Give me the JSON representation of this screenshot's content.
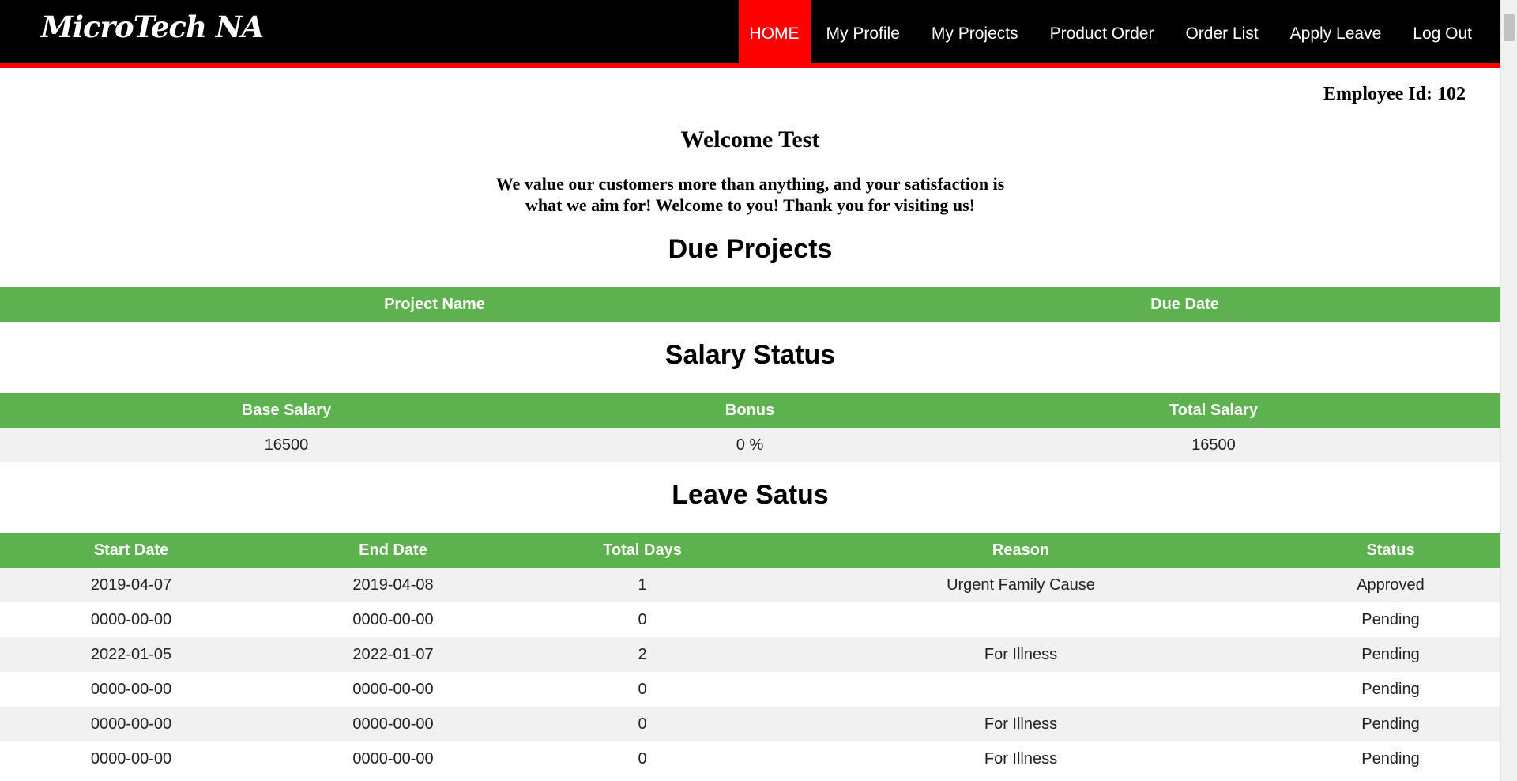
{
  "header": {
    "logo": "MicroTech NA",
    "nav": [
      {
        "label": "HOME",
        "active": true
      },
      {
        "label": "My Profile"
      },
      {
        "label": "My Projects"
      },
      {
        "label": "Product Order"
      },
      {
        "label": "Order List"
      },
      {
        "label": "Apply Leave"
      },
      {
        "label": "Log Out"
      }
    ]
  },
  "employee": {
    "id_text": "Employee Id: 102"
  },
  "welcome": {
    "title": "Welcome Test",
    "line1": "We value our customers more than anything, and your satisfaction is",
    "line2": "what we aim for! Welcome to you! Thank you for visiting us!"
  },
  "due_projects": {
    "title": "Due Projects",
    "columns": [
      "Project Name",
      "Due Date"
    ]
  },
  "salary": {
    "title": "Salary Status",
    "columns": [
      "Base Salary",
      "Bonus",
      "Total Salary"
    ],
    "row": [
      "16500",
      "0 %",
      "16500"
    ]
  },
  "leave": {
    "title": "Leave Satus",
    "columns": [
      "Start Date",
      "End Date",
      "Total Days",
      "Reason",
      "Status"
    ],
    "rows": [
      [
        "2019-04-07",
        "2019-04-08",
        "1",
        "Urgent Family Cause",
        "Approved"
      ],
      [
        "0000-00-00",
        "0000-00-00",
        "0",
        "",
        "Pending"
      ],
      [
        "2022-01-05",
        "2022-01-07",
        "2",
        "For Illness",
        "Pending"
      ],
      [
        "0000-00-00",
        "0000-00-00",
        "0",
        "",
        "Pending"
      ],
      [
        "0000-00-00",
        "0000-00-00",
        "0",
        "For Illness",
        "Pending"
      ],
      [
        "0000-00-00",
        "0000-00-00",
        "0",
        "For Illness",
        "Pending"
      ]
    ]
  },
  "colors": {
    "navbar": "#000000",
    "accent_red": "#ff0000",
    "table_header_green": "#5db14e",
    "row_stripe": "#f1f1f1"
  }
}
